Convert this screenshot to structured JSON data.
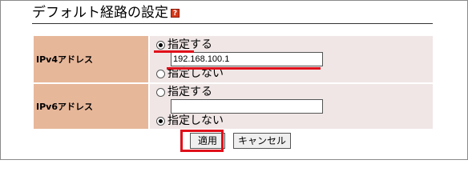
{
  "page": {
    "title": "デフォルト経路の設定",
    "help_icon": "?"
  },
  "ipv4": {
    "label": "IPv4アドレス",
    "option_specify": "指定する",
    "address_value": "192.168.100.1",
    "option_not_specify": "指定しない",
    "selected": "specify"
  },
  "ipv6": {
    "label": "IPv6アドレス",
    "option_specify": "指定する",
    "address_value": "",
    "option_not_specify": "指定しない",
    "selected": "not_specify"
  },
  "buttons": {
    "apply": "適用",
    "cancel": "キャンセル"
  },
  "colors": {
    "label_bg": "#e7b79a",
    "value_bg": "#f0e6e6",
    "annotation_red": "#e0101a"
  }
}
